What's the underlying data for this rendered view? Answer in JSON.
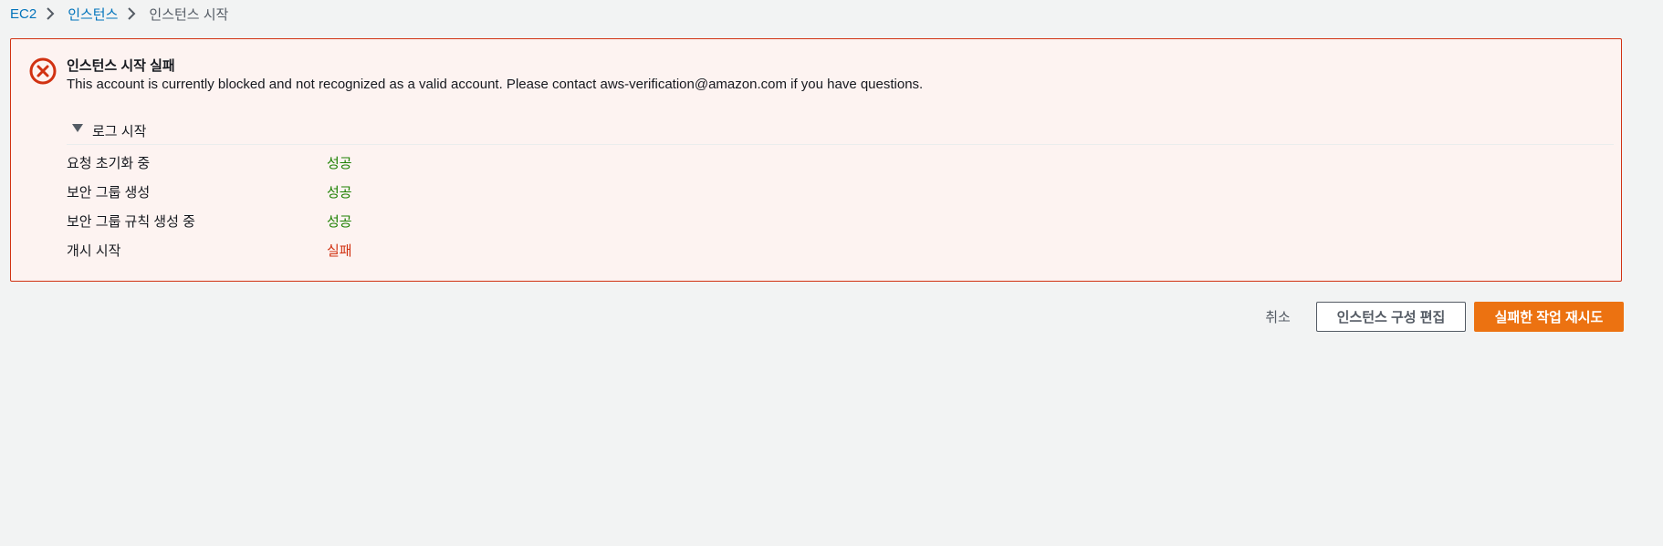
{
  "breadcrumb": {
    "items": [
      {
        "label": "EC2",
        "link": true
      },
      {
        "label": "인스턴스",
        "link": true
      },
      {
        "label": "인스턴스 시작",
        "link": false
      }
    ],
    "separator_icon": "chevron-right-icon"
  },
  "alert": {
    "type": "error",
    "icon": "error-x-circle-icon",
    "title": "인스턴스 시작 실패",
    "message": "This account is currently blocked and not recognized as a valid account. Please contact aws-verification@amazon.com if you have questions.",
    "log": {
      "header": "로그 시작",
      "expanded": true,
      "rows": [
        {
          "step": "요청 초기화 중",
          "status": "성공",
          "state": "success"
        },
        {
          "step": "보안 그룹 생성",
          "status": "성공",
          "state": "success"
        },
        {
          "step": "보안 그룹 규칙 생성 중",
          "status": "성공",
          "state": "success"
        },
        {
          "step": "개시 시작",
          "status": "실패",
          "state": "failure"
        }
      ]
    }
  },
  "actions": {
    "cancel_label": "취소",
    "edit_label": "인스턴스 구성 편집",
    "retry_label": "실패한 작업 재시도"
  },
  "colors": {
    "error": "#d13212",
    "success": "#1d8102",
    "primary": "#ec7211",
    "link": "#0073bb",
    "alert_bg": "#fdf3f1",
    "page_bg": "#f2f3f3"
  }
}
